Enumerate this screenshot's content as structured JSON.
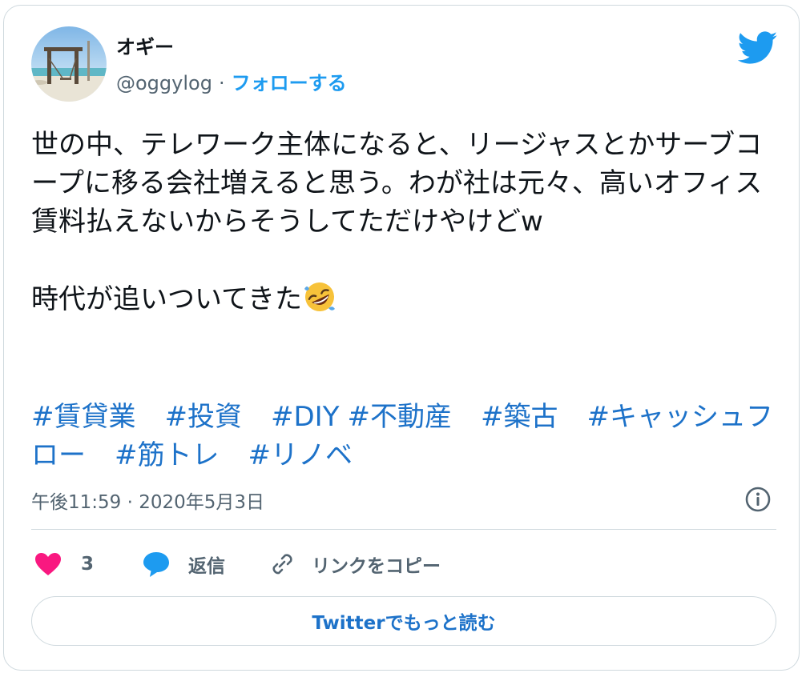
{
  "author": {
    "display_name": "オギー",
    "handle": "@oggylog",
    "separator": "·",
    "follow_label": "フォローする"
  },
  "tweet": {
    "text": "世の中、テレワーク主体になると、リージャスとかサーブコープに移る会社増えると思う。わが社は元々、高いオフィス賃料払えないからそうしてただけやけどw\n\n時代が追いついてきた",
    "emoji": "rolling-on-floor-laughing",
    "hashtags": [
      "#賃貸業",
      "#投資",
      "#DIY",
      "#不動産",
      "#築古",
      "#キャッシュフロー",
      "#筋トレ",
      "#リノベ"
    ]
  },
  "meta": {
    "timestamp": "午後11:59 · 2020年5月3日"
  },
  "actions": {
    "like_count": "3",
    "reply_label": "返信",
    "copy_link_label": "リンクをコピー"
  },
  "footer": {
    "read_more_label": "Twitterでもっと読む"
  },
  "colors": {
    "link": "#1d72c9",
    "brand": "#1d9bf0",
    "like": "#f91880",
    "secondary_text": "#536471",
    "border": "#cfd9de"
  },
  "icons": {
    "brand": "twitter-bird-icon",
    "info": "info-icon",
    "like": "heart-icon",
    "reply": "speech-bubble-icon",
    "copy_link": "link-icon"
  }
}
